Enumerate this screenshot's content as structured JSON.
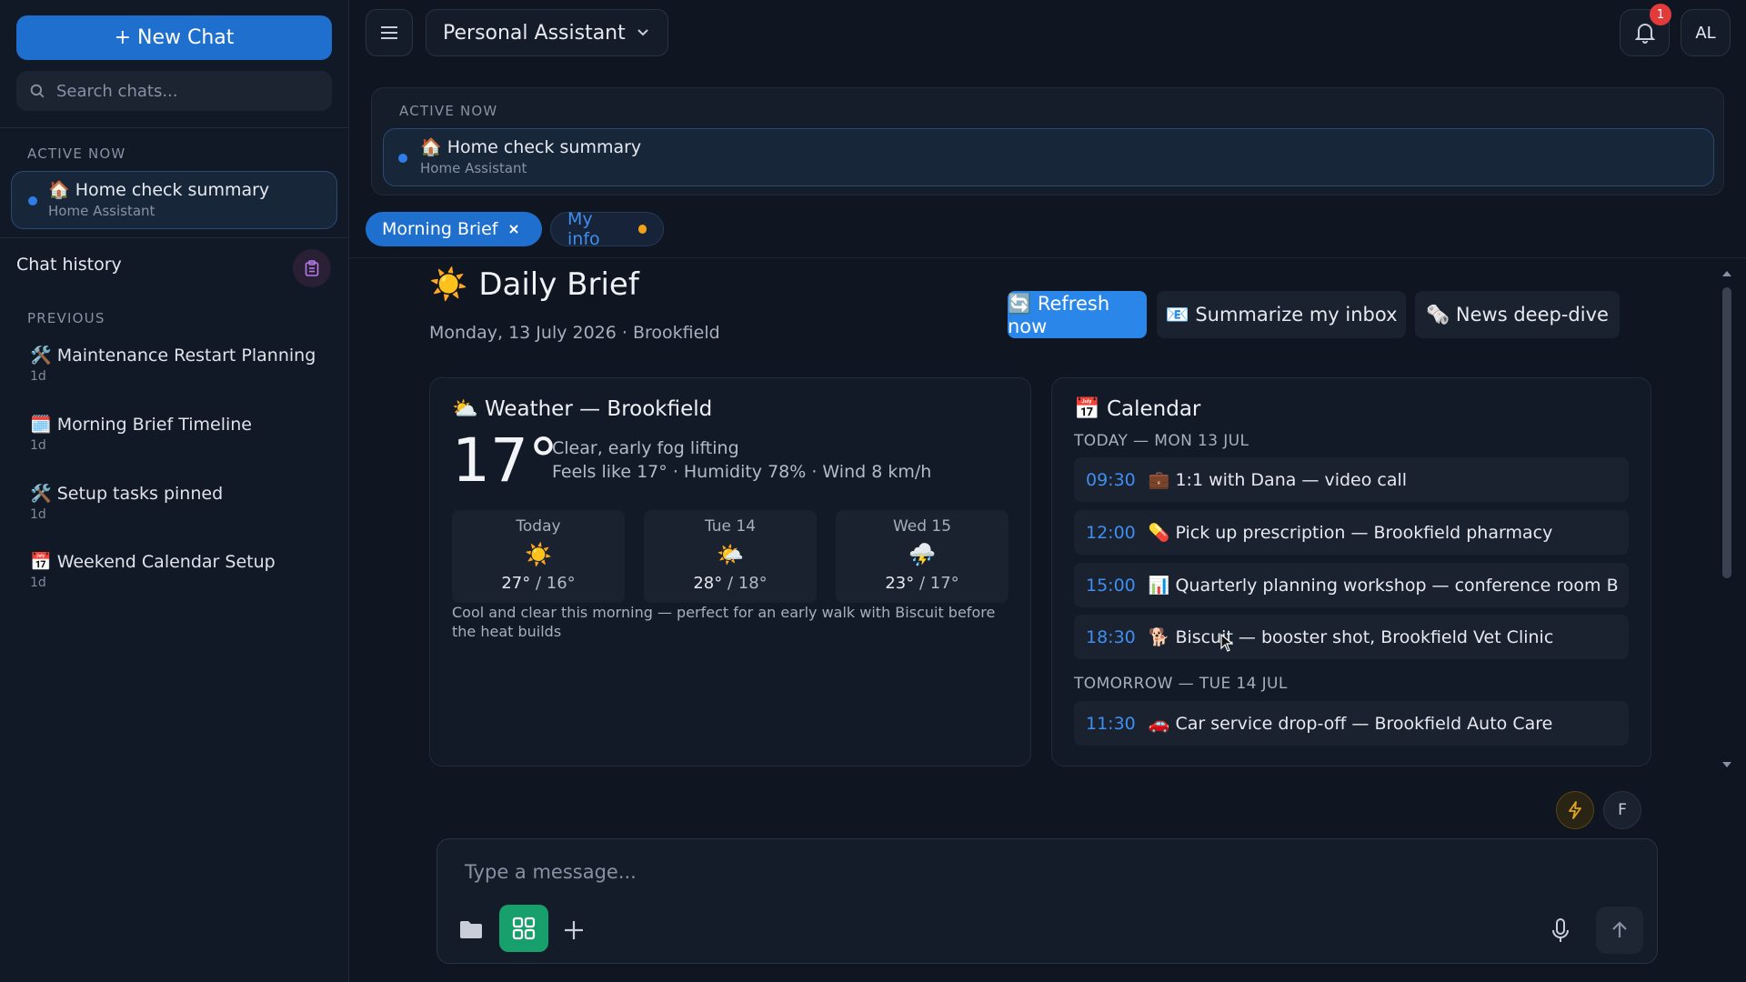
{
  "sidebar": {
    "new_chat_label": "+ New Chat",
    "search_placeholder": "Search chats...",
    "active_now_label": "ACTIVE NOW",
    "active_chat": {
      "title": "🏠 Home check summary",
      "subtitle": "Home Assistant"
    },
    "chat_history_label": "Chat history",
    "previous_label": "PREVIOUS",
    "history": [
      {
        "title": "🛠️ Maintenance Restart Planning",
        "time": "1d"
      },
      {
        "title": "🗓️ Morning Brief Timeline",
        "time": "1d"
      },
      {
        "title": "🛠️ Setup tasks pinned",
        "time": "1d"
      },
      {
        "title": "📅 Weekend Calendar Setup",
        "time": "1d"
      }
    ]
  },
  "header": {
    "assistant_name": "Personal Assistant",
    "notification_count": "1",
    "avatar_initials": "AL"
  },
  "active_banner": {
    "label": "ACTIVE NOW",
    "title": "🏠 Home check summary",
    "subtitle": "Home Assistant"
  },
  "tabs": [
    {
      "label": "Morning Brief",
      "active": true
    },
    {
      "label": "My info",
      "active": false
    }
  ],
  "brief": {
    "icon": "☀️",
    "title": "Daily Brief",
    "date_line": "Monday, 13 July 2026 · Brookfield",
    "actions": {
      "refresh": "🔄 Refresh now",
      "summarize": "📧 Summarize my inbox",
      "news": "🗞️ News deep-dive"
    }
  },
  "weather": {
    "title": "⛅ Weather — Brookfield",
    "temperature": "17°",
    "condition": "Clear, early fog lifting",
    "details": "Feels like 17° · Humidity 78% · Wind 8 km/h",
    "forecast": [
      {
        "day": "Today",
        "icon": "☀️",
        "high": "27°",
        "low": "16°"
      },
      {
        "day": "Tue 14",
        "icon": "🌤️",
        "high": "28°",
        "low": "18°"
      },
      {
        "day": "Wed 15",
        "icon": "⛈️",
        "high": "23°",
        "low": "17°"
      }
    ],
    "note": "Cool and clear this morning — perfect for an early walk with Biscuit before the heat builds"
  },
  "calendar": {
    "title": "📅 Calendar",
    "today_label": "TODAY — MON 13 JUL",
    "today_events": [
      {
        "time": "09:30",
        "text": "💼 1:1 with Dana — video call"
      },
      {
        "time": "12:00",
        "text": "💊 Pick up prescription — Brookfield pharmacy"
      },
      {
        "time": "15:00",
        "text": "📊 Quarterly planning workshop — conference room B"
      },
      {
        "time": "18:30",
        "text": "🐕 Biscuit — booster shot, Brookfield Vet Clinic"
      }
    ],
    "tomorrow_label": "TOMORROW — TUE 14 JUL",
    "tomorrow_events": [
      {
        "time": "11:30",
        "text": "🚗 Car service drop-off — Brookfield Auto Care"
      }
    ]
  },
  "composer": {
    "placeholder": "Type a message...",
    "f_button": "F"
  },
  "colors": {
    "accent_blue": "#1f6fce",
    "green": "#17a06c",
    "badge_red": "#e23b3b",
    "orange": "#f0a21a"
  }
}
